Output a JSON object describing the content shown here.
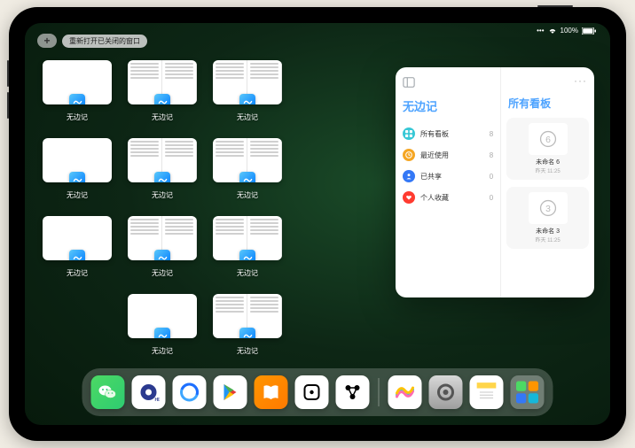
{
  "status": {
    "signal": "•••",
    "wifi": "wifi",
    "battery": "100%"
  },
  "topbar": {
    "add": "+",
    "pill": "重新打开已关闭的窗口"
  },
  "thumb_label": "无边记",
  "grid_items": [
    {
      "type": "blank"
    },
    {
      "type": "split"
    },
    {
      "type": "split"
    },
    null,
    {
      "type": "blank"
    },
    {
      "type": "split"
    },
    {
      "type": "split"
    },
    null,
    {
      "type": "blank"
    },
    {
      "type": "split"
    },
    {
      "type": "split"
    },
    null,
    null,
    {
      "type": "blank"
    },
    {
      "type": "split"
    },
    null
  ],
  "panel": {
    "left": {
      "title": "无边记",
      "items": [
        {
          "label": "所有看板",
          "count": "8",
          "bg": "#38c8d6",
          "glyph": "grid"
        },
        {
          "label": "最近使用",
          "count": "8",
          "bg": "#f5a623",
          "glyph": "clock"
        },
        {
          "label": "已共享",
          "count": "0",
          "bg": "#3478f6",
          "glyph": "person"
        },
        {
          "label": "个人收藏",
          "count": "0",
          "bg": "#ff3b30",
          "glyph": "heart"
        }
      ]
    },
    "right": {
      "title": "所有看板",
      "more": "···",
      "boards": [
        {
          "name": "未命名 6",
          "sub": "昨天 11:25",
          "digit": "6"
        },
        {
          "name": "未命名 3",
          "sub": "昨天 11:25",
          "digit": "3"
        }
      ]
    }
  },
  "dock": [
    {
      "name": "wechat",
      "bg": "linear-gradient(135deg,#4cd964,#2ecc71)",
      "glyph": "wechat"
    },
    {
      "name": "quark",
      "bg": "#fff",
      "glyph": "quark"
    },
    {
      "name": "qqbrowser",
      "bg": "#fff",
      "glyph": "qqb"
    },
    {
      "name": "play",
      "bg": "#fff",
      "glyph": "play"
    },
    {
      "name": "books",
      "bg": "linear-gradient(135deg,#ff9500,#ff7a00)",
      "glyph": "books"
    },
    {
      "name": "dice",
      "bg": "#fff",
      "glyph": "dice"
    },
    {
      "name": "nodes",
      "bg": "#fff",
      "glyph": "nodes"
    },
    {
      "name": "freeform",
      "bg": "#fff",
      "glyph": "freeform"
    },
    {
      "name": "settings",
      "bg": "linear-gradient(180deg,#d8d8d8,#9e9e9e)",
      "glyph": "gear"
    },
    {
      "name": "notes",
      "bg": "#fff",
      "glyph": "notes"
    },
    {
      "name": "recent",
      "bg": "rgba(255,255,255,0.28)",
      "glyph": "recent"
    }
  ]
}
